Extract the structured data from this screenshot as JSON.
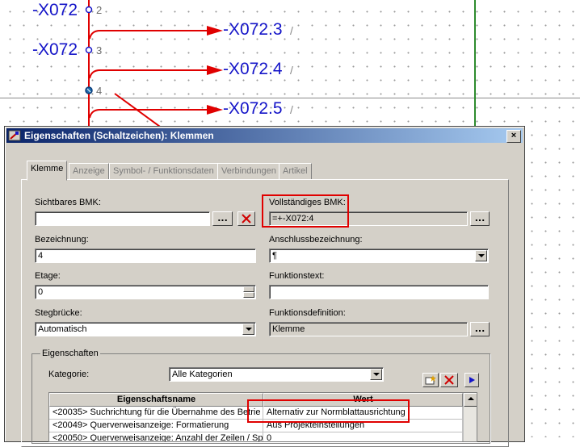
{
  "schematic": {
    "labels": [
      {
        "text": "-X072"
      },
      {
        "text": "-X072"
      }
    ],
    "terminal_numbers": [
      "2",
      "3",
      "4"
    ],
    "targets": [
      "-X072.3",
      "-X072.4",
      "-X072.5"
    ]
  },
  "dialog": {
    "title": "Eigenschaften (Schaltzeichen): Klemmen",
    "close": "×",
    "tabs": [
      "Klemme",
      "Anzeige",
      "Symbol- / Funktionsdaten",
      "Verbindungen",
      "Artikel"
    ],
    "sichtbares_bmk": {
      "label": "Sichtbares BMK:",
      "value": ""
    },
    "vollstaendiges_bmk": {
      "label": "Vollständiges BMK:",
      "value": "=+-X072:4"
    },
    "bezeichnung": {
      "label": "Bezeichnung:",
      "value": "4"
    },
    "anschlussbezeichnung": {
      "label": "Anschlussbezeichnung:",
      "value": "¶"
    },
    "etage": {
      "label": "Etage:",
      "value": "0"
    },
    "funktionstext": {
      "label": "Funktionstext:",
      "value": ""
    },
    "stegbruecke": {
      "label": "Stegbrücke:",
      "value": "Automatisch"
    },
    "funktionsdefinition": {
      "label": "Funktionsdefinition:",
      "value": "Klemme"
    },
    "ellipsis": "...",
    "eigenschaften": {
      "group_label": "Eigenschaften",
      "kategorie_label": "Kategorie:",
      "kategorie_value": "Alle Kategorien",
      "columns": [
        "Eigenschaftsname",
        "Wert"
      ],
      "rows": [
        {
          "name": "<20035> Suchrichtung für die Übernahme des Betrie",
          "value": "Alternativ zur Normblattausrichtung"
        },
        {
          "name": "<20049> Querverweisanzeige: Formatierung",
          "value": "Aus Projekteinstellungen"
        },
        {
          "name": "<20050> Querverweisanzeige: Anzahl der Zeilen / Sp",
          "value": "0"
        }
      ]
    }
  },
  "colors": {
    "accent_red": "#e00000",
    "label_blue": "#1414c8",
    "titlebar": "#0a246a"
  }
}
